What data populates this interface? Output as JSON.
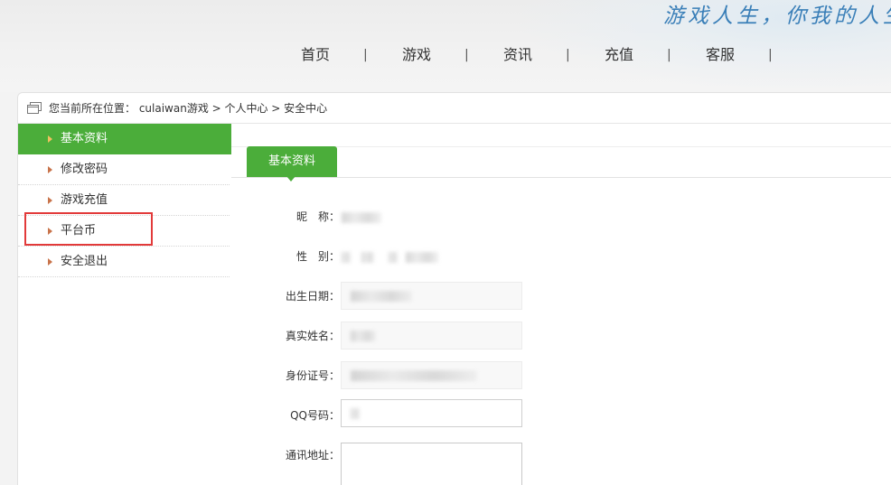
{
  "header": {
    "slogan": "游戏人生，你我的人生",
    "nav": [
      "首页",
      "游戏",
      "资讯",
      "充值",
      "客服"
    ],
    "separator": "|"
  },
  "breadcrumb": {
    "icon": "window-icon",
    "text": "您当前所在位置： culaiwan游戏 > 个人中心 > 安全中心"
  },
  "sidebar": {
    "items": [
      {
        "label": "基本资料",
        "active": true
      },
      {
        "label": "修改密码",
        "active": false
      },
      {
        "label": "游戏充值",
        "active": false
      },
      {
        "label": "平台币",
        "active": false
      },
      {
        "label": "安全退出",
        "active": false
      }
    ],
    "highlight_color": "#e23a3a"
  },
  "content": {
    "tab": "基本资料",
    "fields": {
      "nickname_label": "昵　称：",
      "gender_label": "性　别：",
      "birthday_label": "出生日期：",
      "realname_label": "真实姓名：",
      "idcard_label": "身份证号：",
      "qq_label": "QQ号码：",
      "address_label": "通讯地址："
    }
  },
  "colors": {
    "accent": "#4bad3a",
    "slogan": "#3a7fb8"
  }
}
